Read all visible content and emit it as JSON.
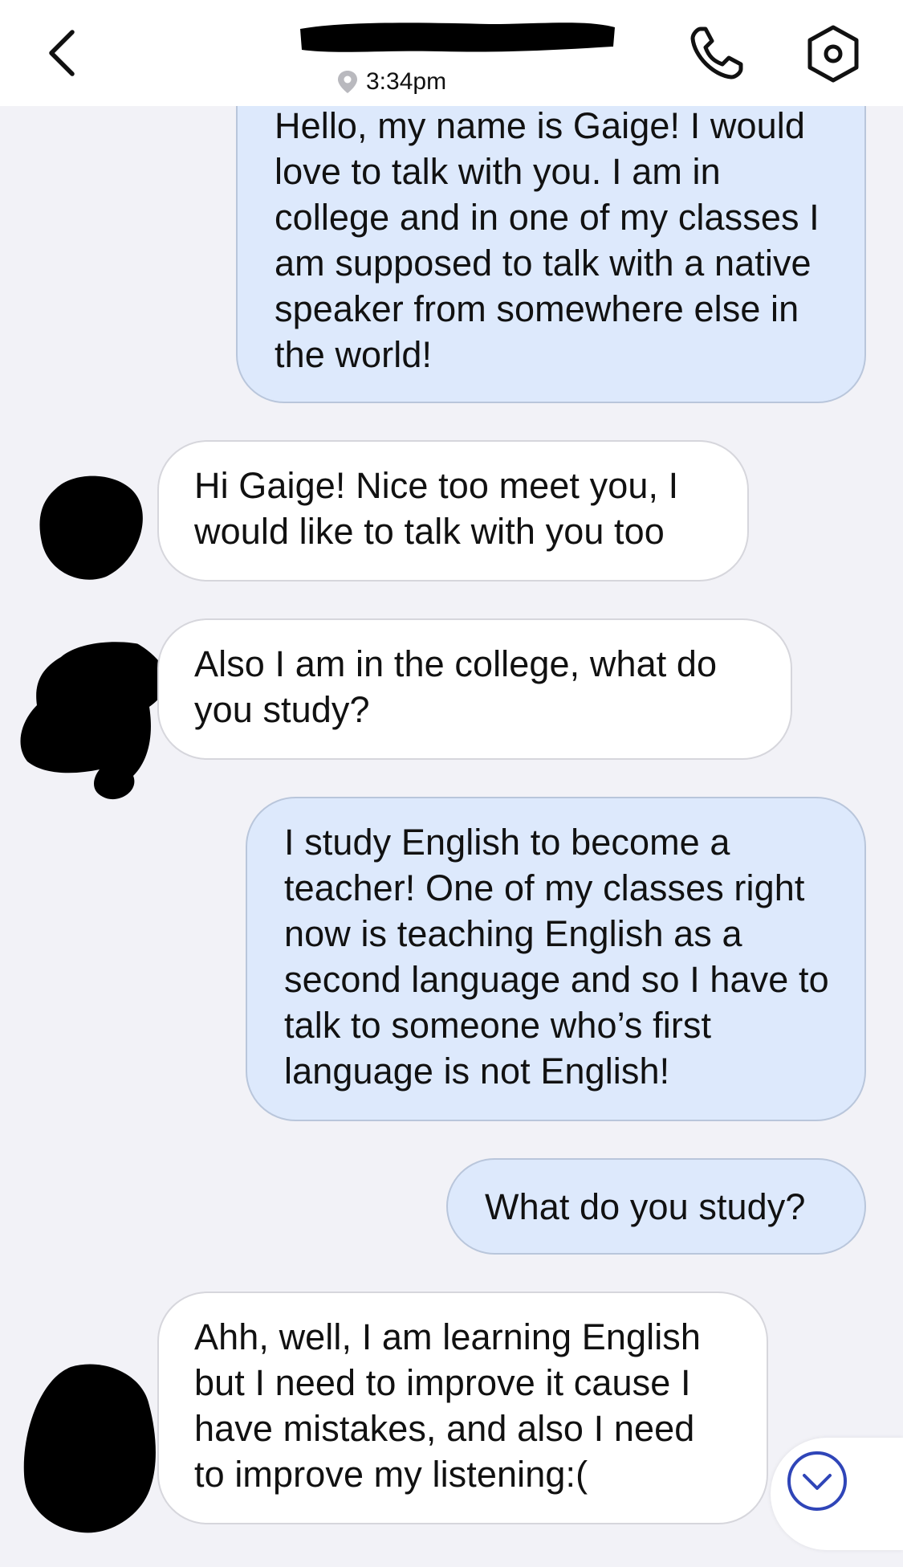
{
  "header": {
    "time": "3:34pm",
    "icons": {
      "back": "chevron-left-icon",
      "location": "location-pin-icon",
      "call": "phone-icon",
      "settings": "settings-icon"
    }
  },
  "messages": [
    {
      "from": "me",
      "text": "Hello, my name is Gaige! I would love to talk with you. I am in college and in one of my classes I am supposed to talk with a native speaker from somewhere else in the world!"
    },
    {
      "from": "them",
      "text": "Hi Gaige! Nice too meet you, I would like to talk with you too"
    },
    {
      "from": "them",
      "text": "Also I am in the college, what do you study?"
    },
    {
      "from": "me",
      "text": "I study English to become a teacher! One of my classes right now is teaching English as a second language and so I have to talk to someone who’s first language is not English!"
    },
    {
      "from": "me",
      "text": "What do you study?"
    },
    {
      "from": "them",
      "text": "Ahh, well, I am learning English but I need to improve it cause I have mistakes, and also I need to improve my listening:("
    }
  ],
  "scroll_button_icon": "chevron-down-circle-icon",
  "colors": {
    "sent_bubble": "#dde9fc",
    "received_bubble": "#ffffff",
    "background": "#f2f2f7",
    "accent": "#2f45b8"
  }
}
